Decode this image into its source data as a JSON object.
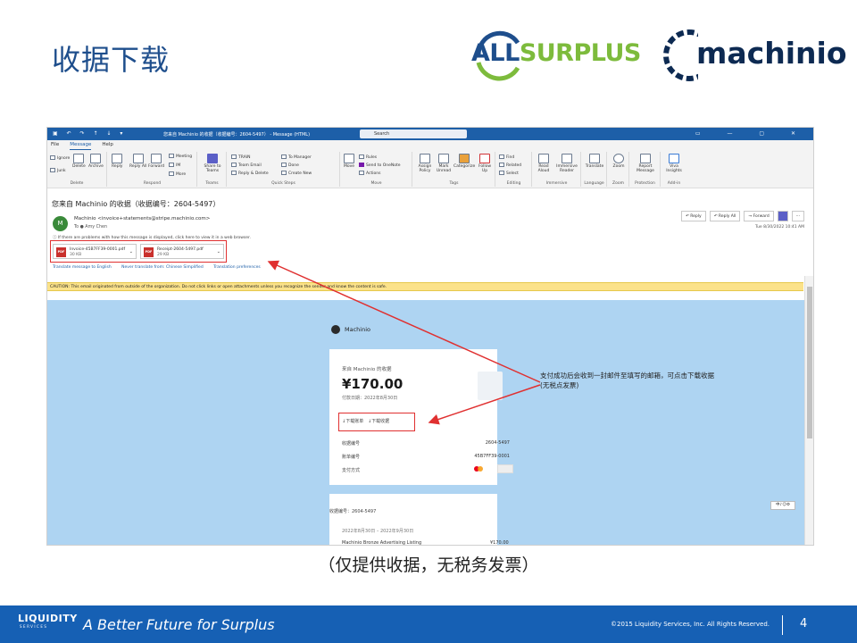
{
  "slide": {
    "title": "收据下载",
    "caption": "（仅提供收据，无税务发票）",
    "page_number": "4",
    "footer_tagline": "A Better Future for Surplus",
    "footer_copyright": "©2015 Liquidity Services, Inc. All Rights Reserved.",
    "footer_logo": "LIQUIDITY",
    "footer_logo_sub": "SERVICES",
    "logo_allsurplus_a": "ALL",
    "logo_allsurplus_b": "SURPLUS",
    "logo_machinio": "machinio"
  },
  "outlook": {
    "window_title": "您来自 Machinio 的收据（收据编号：2604-5497） - Message (HTML)",
    "search_placeholder": "Search",
    "menu": [
      "File",
      "Message",
      "Help"
    ],
    "ribbon_groups": {
      "delete": {
        "label": "Delete",
        "buttons": [
          "Ignore",
          "Junk",
          "Delete",
          "Archive"
        ]
      },
      "respond": {
        "label": "Respond",
        "buttons": [
          "Reply",
          "Reply All",
          "Forward",
          "Meeting",
          "IM",
          "More"
        ]
      },
      "teams": {
        "label": "Teams",
        "buttons": [
          "Share to Teams"
        ]
      },
      "quick_steps": {
        "label": "Quick Steps",
        "items": [
          "TRAIN",
          "Team Email",
          "Reply & Delete",
          "To Manager",
          "Done",
          "Create New"
        ]
      },
      "move": {
        "label": "Move",
        "buttons": [
          "Move",
          "Rules",
          "Send to OneNote",
          "Actions"
        ]
      },
      "tags": {
        "label": "Tags",
        "buttons": [
          "Assign Policy",
          "Mark Unread",
          "Categorize",
          "Follow Up"
        ]
      },
      "editing": {
        "label": "Editing",
        "buttons": [
          "Find",
          "Related",
          "Select"
        ]
      },
      "immersive": {
        "label": "Immersive",
        "buttons": [
          "Read Aloud",
          "Immersive Reader"
        ]
      },
      "language": {
        "label": "Language",
        "buttons": [
          "Translate"
        ]
      },
      "zoom": {
        "label": "Zoom",
        "buttons": [
          "Zoom"
        ]
      },
      "protection": {
        "label": "Protection",
        "buttons": [
          "Report Message"
        ]
      },
      "addin": {
        "label": "Add-in",
        "buttons": [
          "Viva Insights"
        ]
      }
    },
    "subject": "您来自 Machinio 的收据（收据编号：2604-5497）",
    "sender": "Machinio <invoice+statements@stripe.machinio.com>",
    "avatar_letter": "M",
    "to": "To  ● Amy Chen",
    "warning": "ⓘ If there are problems with how this message is displayed, click here to view it in a web browser.",
    "actions": [
      "Reply",
      "Reply All",
      "Forward"
    ],
    "date": "Tue 8/30/2022 10:41 AM",
    "attachments": [
      {
        "name": "Invoice-45B7FF39-0001.pdf",
        "size": "30 KB"
      },
      {
        "name": "Receipt-2604-5497.pdf",
        "size": "29 KB"
      }
    ],
    "translate": [
      "Translate message to English",
      "Never translate from: Chinese Simplified",
      "Translation preferences"
    ],
    "caution": "CAUTION: This email originated from outside of the organization. Do not click links or open attachments unless you recognize the sender and know the content is safe."
  },
  "receipt": {
    "brand": "Machinio",
    "from_label": "来自 Machinio 的收据",
    "amount": "¥170.00",
    "pay_date": "付款日期：2022年8月30日",
    "dl_invoice": "↓下载账单",
    "dl_receipt": "↓下载收据",
    "rows": [
      {
        "k": "收据编号",
        "v": "2604-5497"
      },
      {
        "k": "账单编号",
        "v": "45B7FF39-0001"
      },
      {
        "k": "支付方式",
        "v": ""
      }
    ],
    "receipt_no": "收据编号：2604-5497",
    "range": "2022年8月30日 – 2022年9月30日",
    "line_item": "Machinio Bronze Advertising Listing",
    "line_amount": "¥170.00",
    "float_widget": "中♪☺⚙"
  },
  "annotation": {
    "line1": "支付成功后会收到一封邮件至填写的邮箱，可点击下载收据",
    "line2": "(无税点发票)"
  },
  "colors": {
    "title_blue": "#1e4e8c",
    "footer_blue": "#1660b4",
    "email_bg": "#aed4f2",
    "highlight_red": "#e03030",
    "arrow_red": "#e03030"
  }
}
